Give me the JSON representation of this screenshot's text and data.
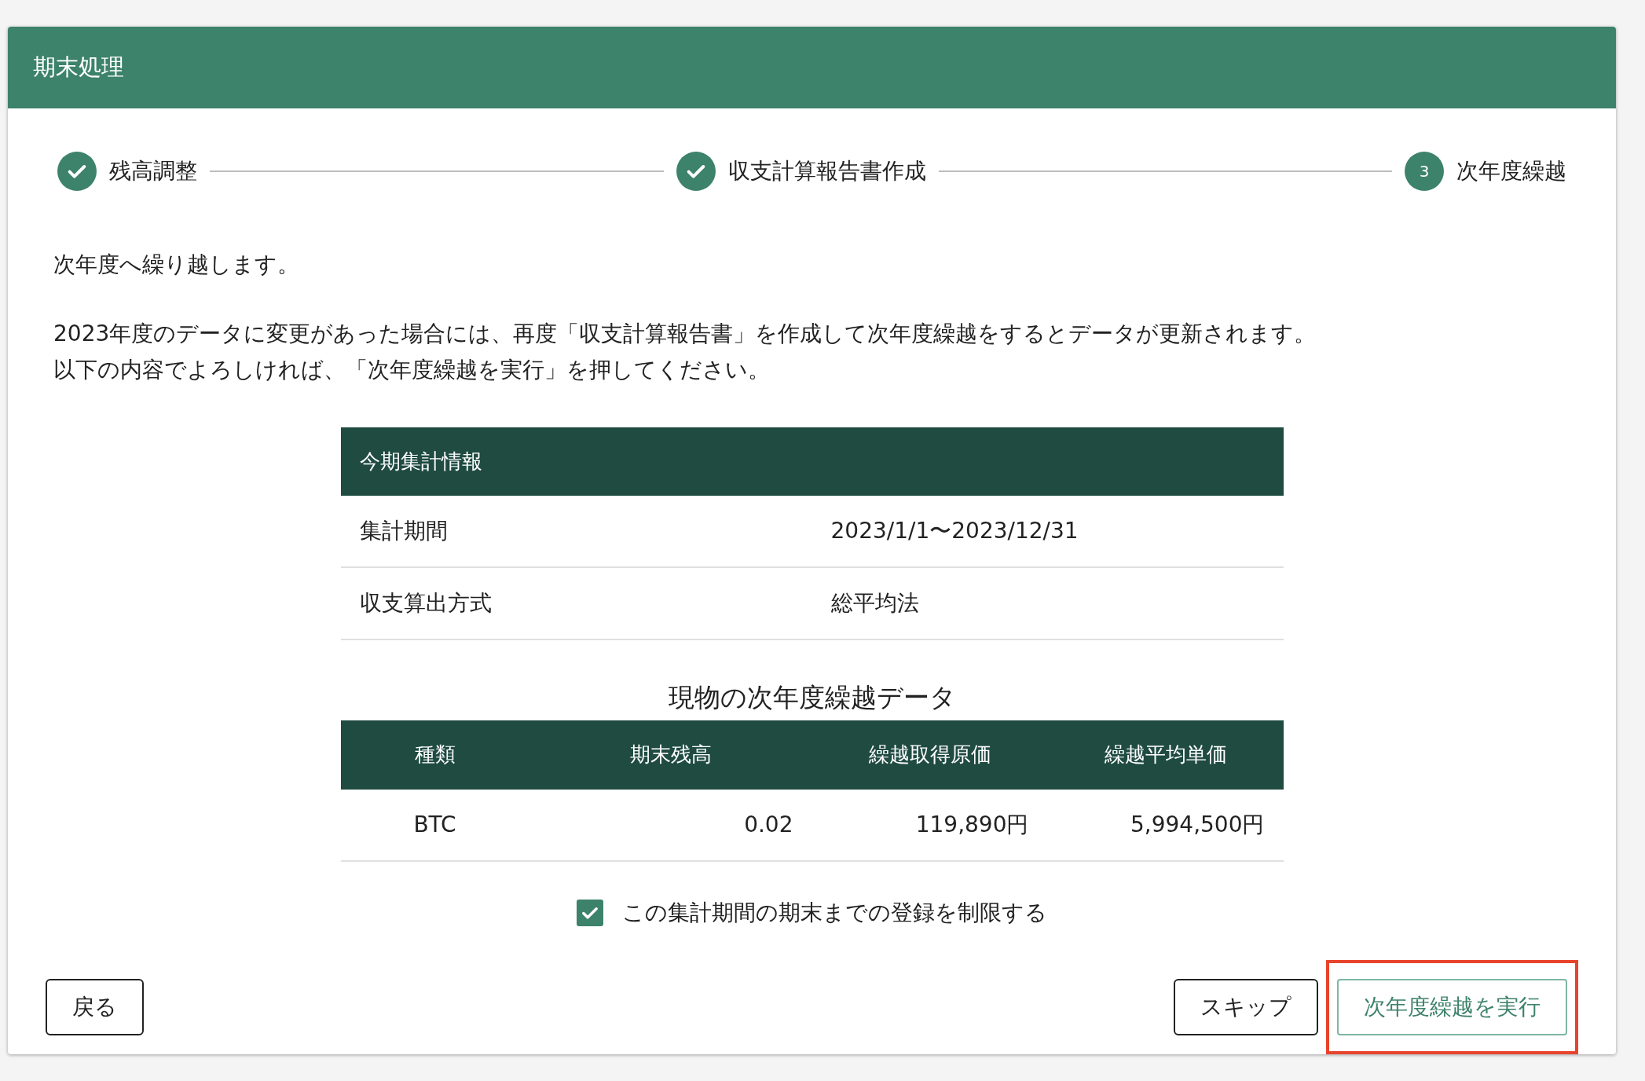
{
  "header": {
    "title": "期末処理"
  },
  "steps": [
    {
      "label": "残高調整",
      "completed": true
    },
    {
      "label": "収支計算報告書作成",
      "completed": true
    },
    {
      "label": "次年度繰越",
      "completed": false,
      "number": "3"
    }
  ],
  "intro": "次年度へ繰り越します。",
  "notes": [
    "2023年度のデータに変更があった場合には、再度「収支計算報告書」を作成して次年度繰越をするとデータが更新されます。",
    "以下の内容でよろしければ、「次年度繰越を実行」を押してください。"
  ],
  "summary_table": {
    "title": "今期集計情報",
    "rows": [
      {
        "label": "集計期間",
        "value": "2023/1/1〜2023/12/31"
      },
      {
        "label": "収支算出方式",
        "value": "総平均法"
      }
    ]
  },
  "carryover_table": {
    "title": "現物の次年度繰越データ",
    "columns": [
      "種類",
      "期末残高",
      "繰越取得原価",
      "繰越平均単価"
    ],
    "rows": [
      {
        "cells": [
          "BTC",
          "0.02",
          "119,890円",
          "5,994,500円"
        ]
      }
    ]
  },
  "restrict_checkbox": {
    "label": "この集計期間の期末までの登録を制限する",
    "checked": true
  },
  "buttons": [
    {
      "label": "戻る",
      "kind": "outlined",
      "highlighted": false
    },
    {
      "label": "スキップ",
      "kind": "outlined",
      "highlighted": false
    },
    {
      "label": "次年度繰越を実行",
      "kind": "primary",
      "highlighted": true
    }
  ]
}
